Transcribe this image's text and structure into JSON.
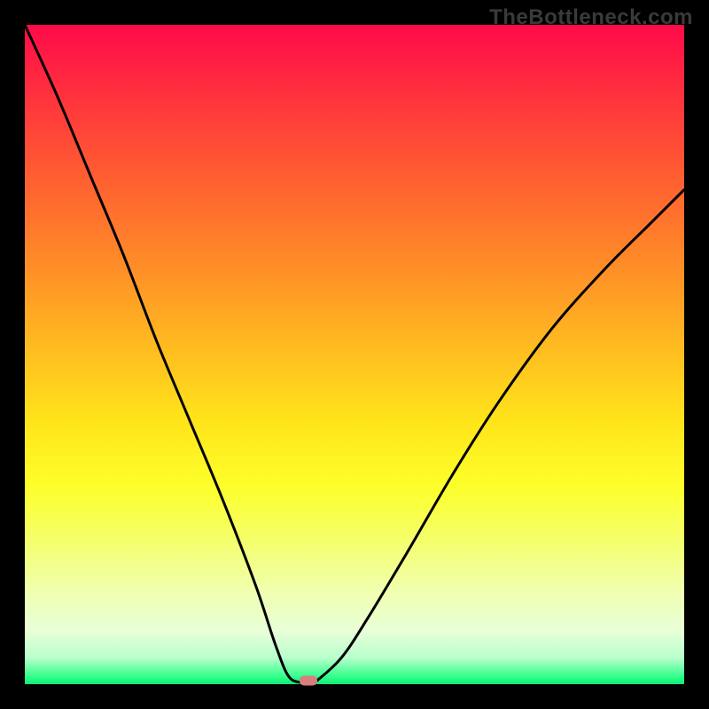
{
  "watermark": "TheBottleneck.com",
  "colors": {
    "top": "#ff0a4a",
    "mid": "#ffe41a",
    "bottom": "#10e878",
    "curve": "#000000",
    "marker": "#d97d7d",
    "frame": "#000000"
  },
  "chart_data": {
    "type": "line",
    "title": "",
    "xlabel": "",
    "ylabel": "",
    "xlim": [
      0,
      100
    ],
    "ylim": [
      0,
      100
    ],
    "grid": false,
    "legend": false,
    "annotations": [],
    "series": [
      {
        "name": "bottleneck-curve",
        "x": [
          0,
          5,
          10,
          15,
          20,
          25,
          30,
          35,
          38,
          40,
          42,
          43,
          44,
          48,
          52,
          58,
          65,
          72,
          80,
          88,
          95,
          100
        ],
        "y": [
          100,
          89,
          77,
          65,
          52,
          40,
          28,
          15,
          6,
          1.2,
          0.2,
          0,
          0.3,
          4,
          10,
          20,
          32,
          43,
          54,
          63,
          70,
          75
        ]
      }
    ],
    "marker": {
      "x": 43,
      "y": 0.5
    }
  }
}
